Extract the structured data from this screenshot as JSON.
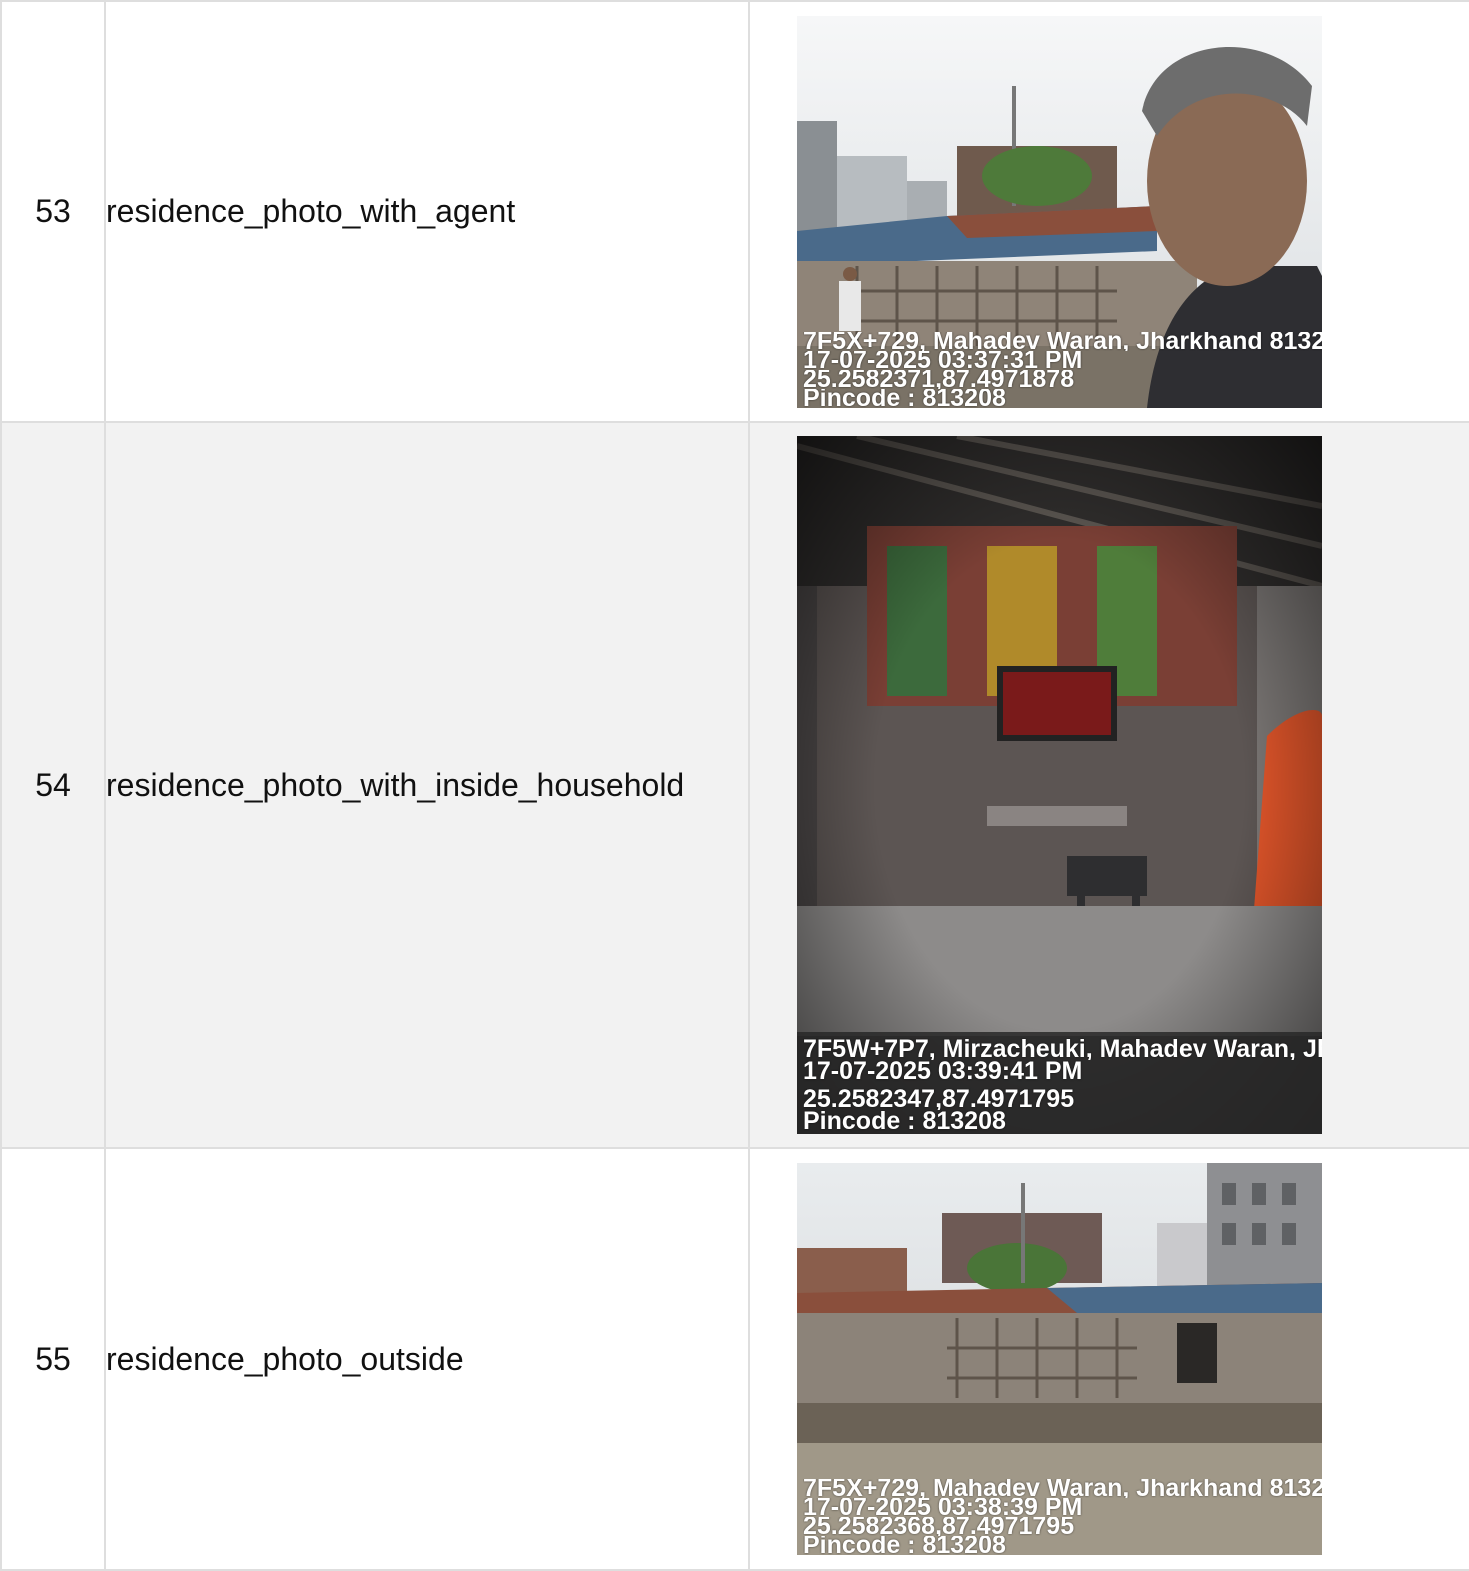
{
  "rows": [
    {
      "number": "53",
      "field": "residence_photo_with_agent",
      "photo": {
        "description": "selfie of agent in front of residence",
        "stamp_address": "7F5X+729, Mahadev Waran, Jharkhand 8132",
        "stamp_datetime": "17-07-2025 03:37:31 PM",
        "stamp_coords": "25.2582371,87.4971878",
        "stamp_pincode": "Pincode : 813208"
      }
    },
    {
      "number": "54",
      "field": "residence_photo_with_inside_household",
      "photo": {
        "description": "interior of household",
        "stamp_address": "7F5W+7P7, Mirzacheuki, Mahadev Waran, Jh",
        "stamp_datetime": "17-07-2025 03:39:41 PM",
        "stamp_coords": "25.2582347,87.4971795",
        "stamp_pincode": "Pincode : 813208"
      }
    },
    {
      "number": "55",
      "field": "residence_photo_outside",
      "photo": {
        "description": "exterior of residence",
        "stamp_address": "7F5X+729, Mahadev Waran, Jharkhand 8132",
        "stamp_datetime": "17-07-2025 03:38:39 PM",
        "stamp_coords": "25.2582368,87.4971795",
        "stamp_pincode": "Pincode : 813208"
      }
    }
  ],
  "colors": {
    "border": "#dedede",
    "alt_row": "#f2f2f2",
    "text": "#111111"
  }
}
